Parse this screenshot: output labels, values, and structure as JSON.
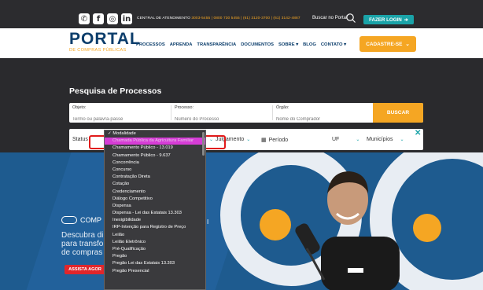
{
  "topbar": {
    "social": [
      {
        "icon": "whatsapp-icon",
        "glyph": "✆"
      },
      {
        "icon": "facebook-icon",
        "glyph": "f"
      },
      {
        "icon": "instagram-icon",
        "glyph": "◎"
      },
      {
        "icon": "linkedin-icon",
        "glyph": "in"
      }
    ],
    "contact_prefix": "CENTRAL DE ATENDIMENTO",
    "contact_numbers": "3003-5455 | 0800 730 5455 | (61) 3120-3700 | (61) 3142-4887",
    "search_label": "Buscar no Portal",
    "login_label": "FAZER LOGIN"
  },
  "nav": {
    "logo_main": "PORTAL",
    "logo_sub": "DE COMPRAS PÚBLICAS",
    "items": [
      "PROCESSOS",
      "APRENDA",
      "TRANSPARÊNCIA",
      "DOCUMENTOS",
      "SOBRE ▾",
      "BLOG",
      "CONTATO ▾"
    ],
    "cadastro_label": "CADASTRE-SE"
  },
  "search": {
    "title": "Pesquisa de Processos",
    "objeto_label": "Objeto:",
    "objeto_placeholder": "Termo ou palavra-passe",
    "processo_label": "Processo:",
    "processo_placeholder": "Número do Processo",
    "orgao_label": "Órgão:",
    "orgao_placeholder": "Nome do Comprador",
    "buscar_label": "BUSCAR"
  },
  "filters": {
    "status": "Status",
    "julgamento": "Julgamento",
    "periodo": "Período",
    "uf": "UF",
    "municipios": "Municípios"
  },
  "dropdown": {
    "header": "✓ Modalidade",
    "options": [
      "Chamada Pública da Agricultura Familiar",
      "Chamamento Público - 13.019",
      "Chamamento Público - 9.637",
      "Concorrência",
      "Concurso",
      "Contratação Direta",
      "Cotação",
      "Credenciamento",
      "Diálogo Competitivo",
      "Dispensa",
      "Dispensa - Lei das Estatais 13.303",
      "Inexigibilidade",
      "IRP-Intenção para Registro de Preço",
      "Leilão",
      "Leilão Eletrônico",
      "Pré-Qualificação",
      "Pregão",
      "Pregão Lei das Estatais 13.303",
      "Pregão Presencial"
    ]
  },
  "hero": {
    "brand": "COMP",
    "headline_1": "Descubra di",
    "headline_2": "para transfo",
    "headline_3": "de compras",
    "cta": "ASSISTA AGOR",
    "right_letter": "I"
  },
  "colors": {
    "accent_orange": "#f5a623",
    "teal": "#1aa3a8",
    "navy": "#0b3d6b",
    "highlight_red": "#e11a1a",
    "selected_magenta": "#d63dd6"
  }
}
